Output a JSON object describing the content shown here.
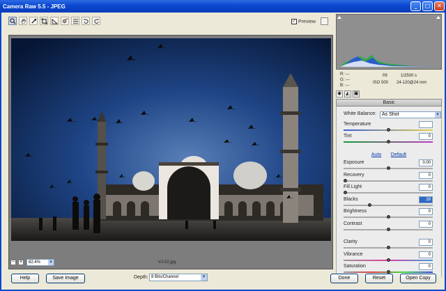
{
  "window": {
    "title": "Camera Raw 5.5  -  JPEG"
  },
  "toolbar": {
    "tools": [
      "zoom-tool",
      "hand-tool",
      "white-balance-tool",
      "crop-tool",
      "straighten-tool",
      "red-eye-tool",
      "preferences-tool",
      "rotate-left-tool",
      "rotate-right-tool"
    ],
    "preview_label": "Preview",
    "preview_checked": true
  },
  "image": {
    "filename": "VJ-02.jpg",
    "zoom": "82.4%"
  },
  "info": {
    "r_label": "R:",
    "g_label": "G:",
    "b_label": "B:",
    "r": "---",
    "g": "---",
    "b": "---",
    "aperture": "f/9",
    "shutter": "1/2500 s",
    "iso": "ISO 500",
    "lens": "24-120@24 mm"
  },
  "panel": {
    "title": "Basic",
    "white_balance_label": "White Balance:",
    "white_balance_value": "As Shot",
    "auto_label": "Auto",
    "default_label": "Default",
    "sliders": [
      {
        "label": "Temperature",
        "value": "",
        "pos": 0.5
      },
      {
        "label": "Tint",
        "value": "0",
        "pos": 0.5
      },
      {
        "label": "Exposure",
        "value": "0.00",
        "pos": 0.5
      },
      {
        "label": "Recovery",
        "value": "0",
        "pos": 0.0
      },
      {
        "label": "Fill Light",
        "value": "0",
        "pos": 0.0
      },
      {
        "label": "Blacks",
        "value": "28",
        "pos": 0.28
      },
      {
        "label": "Brightness",
        "value": "0",
        "pos": 0.5
      },
      {
        "label": "Contrast",
        "value": "0",
        "pos": 0.5
      },
      {
        "label": "Clarity",
        "value": "0",
        "pos": 0.5
      },
      {
        "label": "Vibrance",
        "value": "0",
        "pos": 0.5
      },
      {
        "label": "Saturation",
        "value": "0",
        "pos": 0.5
      }
    ]
  },
  "footer": {
    "help_label": "Help",
    "save_label": "Save Image",
    "depth_label": "Depth:",
    "depth_value": "8 Bits/Channel",
    "done_label": "Done",
    "reset_label": "Reset",
    "open_label": "Open Copy"
  },
  "colors": {
    "titlebar": "#0a48d0",
    "sky": "#0d2c66",
    "accent": "#316ac5"
  }
}
